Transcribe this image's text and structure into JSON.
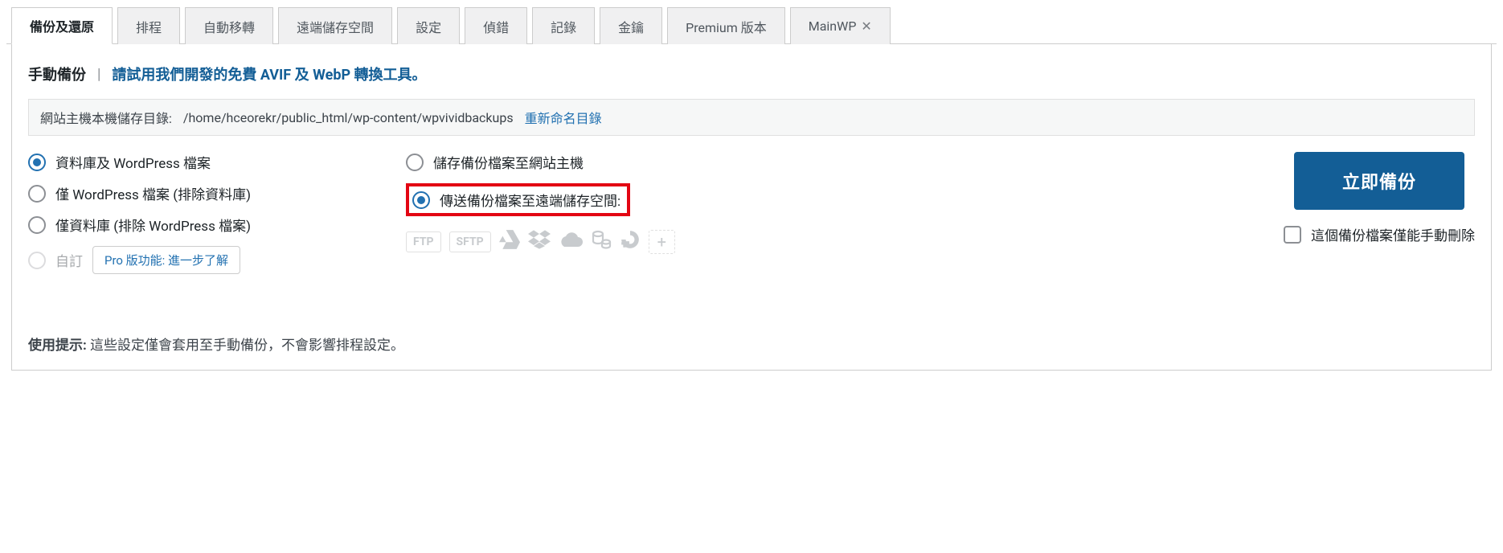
{
  "tabs": {
    "items": [
      {
        "label": "備份及還原",
        "active": true,
        "closable": false
      },
      {
        "label": "排程",
        "active": false,
        "closable": false
      },
      {
        "label": "自動移轉",
        "active": false,
        "closable": false
      },
      {
        "label": "遠端儲存空間",
        "active": false,
        "closable": false
      },
      {
        "label": "設定",
        "active": false,
        "closable": false
      },
      {
        "label": "偵錯",
        "active": false,
        "closable": false
      },
      {
        "label": "記錄",
        "active": false,
        "closable": false
      },
      {
        "label": "金鑰",
        "active": false,
        "closable": false
      },
      {
        "label": "Premium 版本",
        "active": false,
        "closable": false
      },
      {
        "label": "MainWP",
        "active": false,
        "closable": true
      }
    ]
  },
  "heading": {
    "title": "手動備份",
    "divider": "|",
    "link": "請試用我們開發的免費 AVIF 及 WebP 轉換工具。"
  },
  "path_bar": {
    "label": "網站主機本機儲存目錄:",
    "path": "/home/hceorekr/public_html/wp-content/wpvividbackups",
    "rename": "重新命名目錄"
  },
  "left_radios": {
    "opt0": {
      "label": "資料庫及 WordPress 檔案",
      "checked": true,
      "disabled": false
    },
    "opt1": {
      "label": "僅 WordPress 檔案 (排除資料庫)",
      "checked": false,
      "disabled": false
    },
    "opt2": {
      "label": "僅資料庫 (排除 WordPress 檔案)",
      "checked": false,
      "disabled": false
    },
    "opt3": {
      "label": "自訂",
      "checked": false,
      "disabled": true,
      "pro_link": "Pro 版功能: 進一步了解"
    }
  },
  "mid_radios": {
    "opt0": {
      "label": "儲存備份檔案至網站主機",
      "checked": false
    },
    "opt1": {
      "label": "傳送備份檔案至遠端儲存空間:",
      "checked": true
    }
  },
  "storage_icons": {
    "chip0": "FTP",
    "chip1": "SFTP",
    "icon0": "gdrive-icon",
    "icon1": "dropbox-icon",
    "icon2": "onedrive-icon",
    "icon3": "s3-icon",
    "icon4": "do-icon",
    "add": "+"
  },
  "right": {
    "button": "立即備份",
    "checkbox": "這個備份檔案僅能手動刪除"
  },
  "footer": {
    "prefix": "使用提示:",
    "text": " 這些設定僅會套用至手動備份，不會影響排程設定。"
  }
}
